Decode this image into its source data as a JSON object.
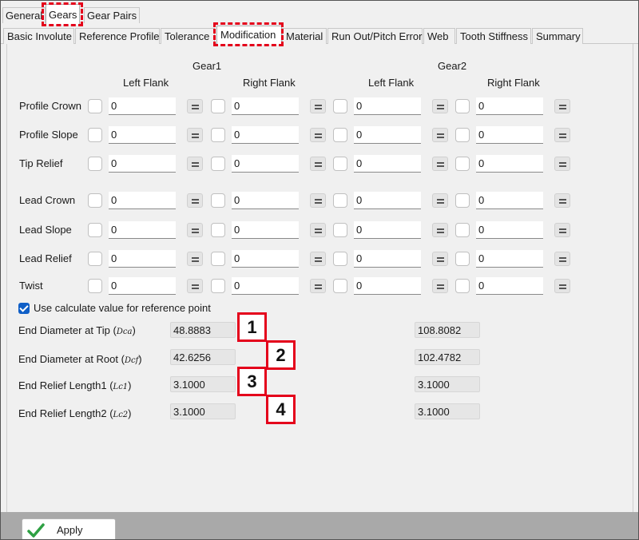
{
  "top_tabs": [
    "General",
    "Gears",
    "Gear Pairs"
  ],
  "sub_tabs": [
    "Basic Involute",
    "Reference Profile",
    "Tolerance",
    "Modification",
    "Material",
    "Run Out/Pitch Error",
    "Web",
    "Tooth Stiffness",
    "Summary"
  ],
  "headers": {
    "gear1": "Gear1",
    "gear2": "Gear2",
    "left_flank": "Left Flank",
    "right_flank": "Right Flank"
  },
  "rows": [
    {
      "label": "Profile Crown",
      "values": [
        "0",
        "0",
        "0",
        "0"
      ]
    },
    {
      "label": "Profile Slope",
      "values": [
        "0",
        "0",
        "0",
        "0"
      ]
    },
    {
      "label": "Tip Relief",
      "values": [
        "0",
        "0",
        "0",
        "0"
      ]
    },
    {
      "label": "Lead Crown",
      "values": [
        "0",
        "0",
        "0",
        "0"
      ]
    },
    {
      "label": "Lead Slope",
      "values": [
        "0",
        "0",
        "0",
        "0"
      ]
    },
    {
      "label": "Lead Relief",
      "values": [
        "0",
        "0",
        "0",
        "0"
      ]
    },
    {
      "label": "Twist",
      "values": [
        "0",
        "0",
        "0",
        "0"
      ]
    }
  ],
  "reference_checkbox": {
    "label": "Use calculate value for reference point",
    "checked": true
  },
  "end_rows": [
    {
      "label": "End Diameter at Tip",
      "symbol": "Dca",
      "gear1": "48.8883",
      "gear2": "108.8082"
    },
    {
      "label": "End Diameter at Root",
      "symbol": "Dcf",
      "gear1": "42.6256",
      "gear2": "102.4782"
    },
    {
      "label": "End Relief Length1",
      "symbol": "Lc1",
      "gear1": "3.1000",
      "gear2": "3.1000"
    },
    {
      "label": "End Relief Length2",
      "symbol": "Lc2",
      "gear1": "3.1000",
      "gear2": "3.1000"
    }
  ],
  "callouts": [
    "1",
    "2",
    "3",
    "4"
  ],
  "apply_label": "Apply",
  "icons": {
    "apply": "checkmark-icon",
    "equal": "equal-icon"
  },
  "colors": {
    "highlight": "#e4001b",
    "checkbox_checked": "#0f5fc7",
    "apply_check": "#2ea043"
  }
}
